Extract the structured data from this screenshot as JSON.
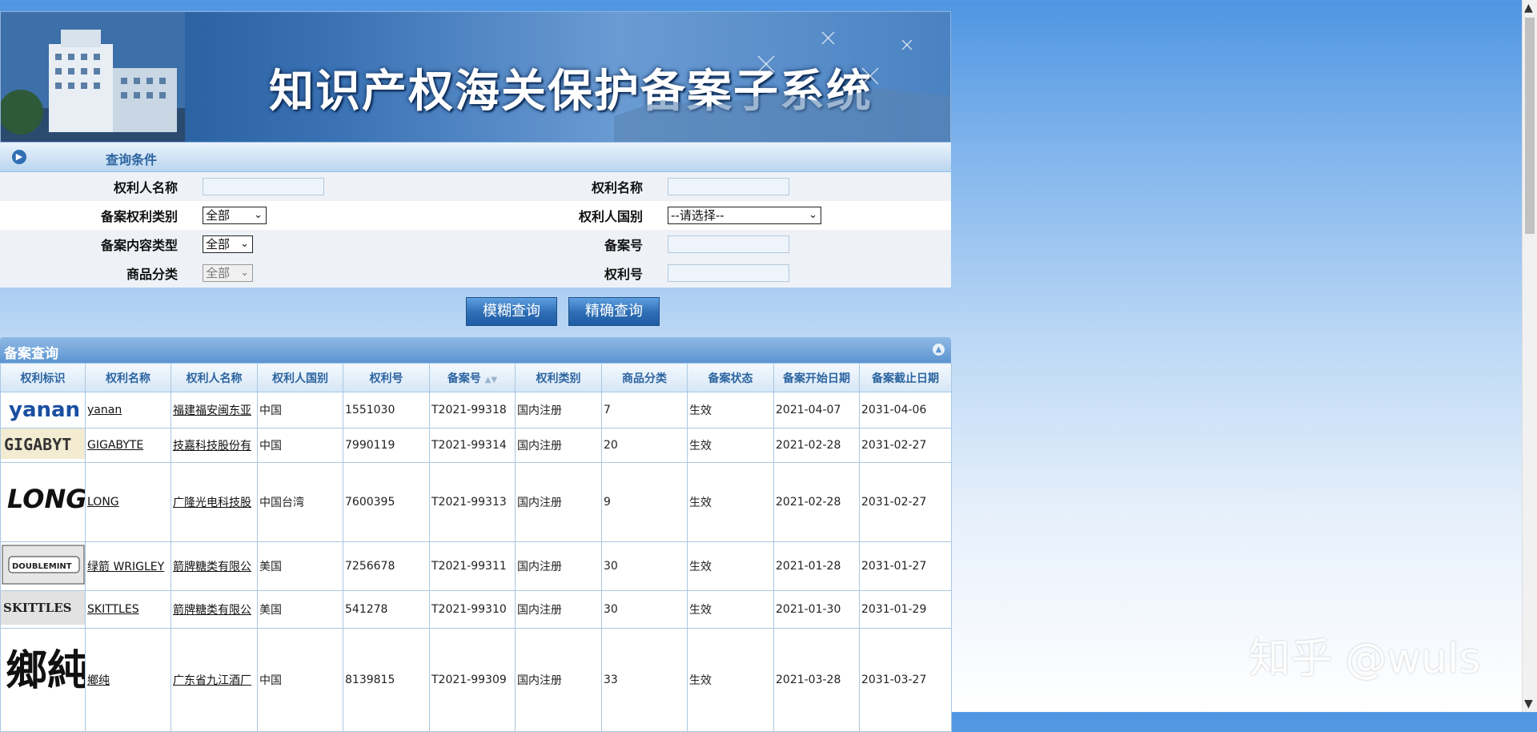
{
  "banner": {
    "title": "知识产权海关保护备案子系统"
  },
  "query": {
    "section_title": "查询条件",
    "fields": {
      "holder_name_label": "权利人名称",
      "right_name_label": "权利名称",
      "record_type_label": "备案权利类别",
      "record_type_value": "全部",
      "holder_country_label": "权利人国别",
      "holder_country_value": "--请选择--",
      "content_type_label": "备案内容类型",
      "content_type_value": "全部",
      "record_no_label": "备案号",
      "goods_class_label": "商品分类",
      "goods_class_value": "全部",
      "right_no_label": "权利号"
    },
    "fuzzy_button": "模糊查询",
    "exact_button": "精确查询"
  },
  "results": {
    "section_title": "备案查询",
    "columns": [
      "权利标识",
      "权利名称",
      "权利人名称",
      "权利人国别",
      "权利号",
      "备案号",
      "权利类别",
      "商品分类",
      "备案状态",
      "备案开始日期",
      "备案截止日期"
    ],
    "rows": [
      {
        "logo": "yanan",
        "name": "yanan",
        "holder": "福建福安闽东亚",
        "country": "中国",
        "right_no": "1551030",
        "record_no": "T2021-99318",
        "type": "国内注册",
        "class": "7",
        "status": "生效",
        "start": "2021-04-07",
        "end": "2031-04-06"
      },
      {
        "logo": "GIGABYT",
        "name": "GIGABYTE",
        "holder": "技嘉科技股份有",
        "country": "中国",
        "right_no": "7990119",
        "record_no": "T2021-99314",
        "type": "国内注册",
        "class": "20",
        "status": "生效",
        "start": "2021-02-28",
        "end": "2031-02-27"
      },
      {
        "logo": "LONG",
        "name": "LONG",
        "holder": "广隆光电科技股",
        "country": "中国台湾",
        "right_no": "7600395",
        "record_no": "T2021-99313",
        "type": "国内注册",
        "class": "9",
        "status": "生效",
        "start": "2021-02-28",
        "end": "2031-02-27"
      },
      {
        "logo": "DOUBLEMINT",
        "name": "绿箭 WRIGLEY",
        "holder": "箭牌糖类有限公",
        "country": "美国",
        "right_no": "7256678",
        "record_no": "T2021-99311",
        "type": "国内注册",
        "class": "30",
        "status": "生效",
        "start": "2021-01-28",
        "end": "2031-01-27"
      },
      {
        "logo": "SKITTLES",
        "name": "SKITTLES",
        "holder": "箭牌糖类有限公",
        "country": "美国",
        "right_no": "541278",
        "record_no": "T2021-99310",
        "type": "国内注册",
        "class": "30",
        "status": "生效",
        "start": "2021-01-30",
        "end": "2031-01-29"
      },
      {
        "logo": "鄉純",
        "name": "鄉纯",
        "holder": "广东省九江酒厂",
        "country": "中国",
        "right_no": "8139815",
        "record_no": "T2021-99309",
        "type": "国内注册",
        "class": "33",
        "status": "生效",
        "start": "2021-03-28",
        "end": "2031-03-27"
      }
    ]
  },
  "watermark": "知乎 @wuls"
}
